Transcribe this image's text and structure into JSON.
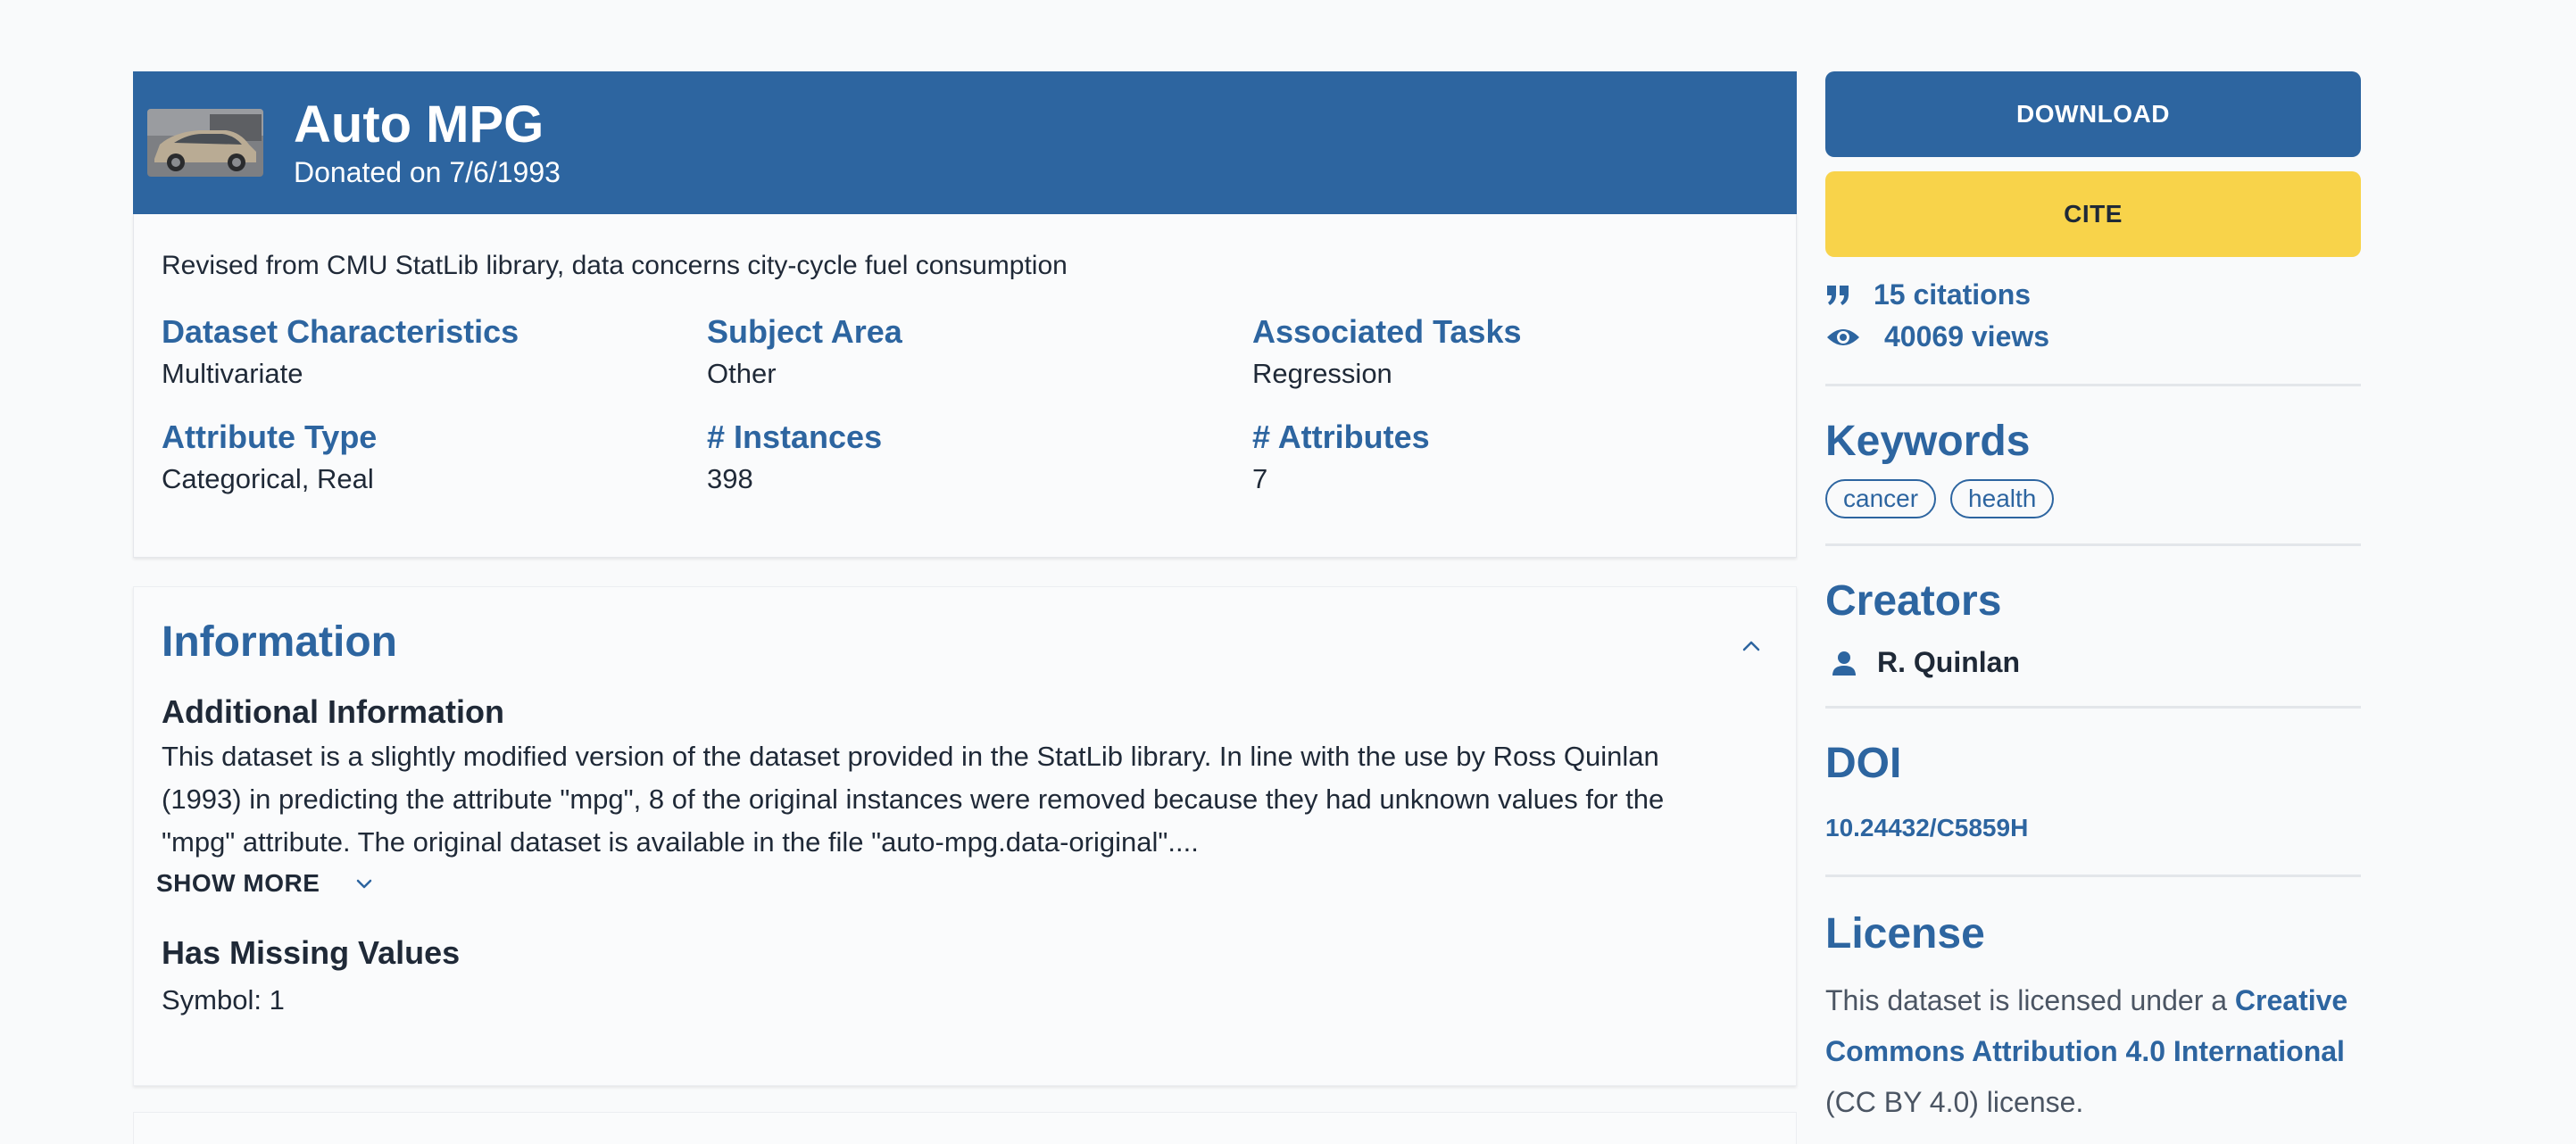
{
  "dataset": {
    "title": "Auto MPG",
    "donated": "Donated on 7/6/1993",
    "description": "Revised from CMU StatLib library, data concerns city-cycle fuel consumption",
    "facts": [
      {
        "label": "Dataset Characteristics",
        "value": "Multivariate"
      },
      {
        "label": "Subject Area",
        "value": "Other"
      },
      {
        "label": "Associated Tasks",
        "value": "Regression"
      },
      {
        "label": "Attribute Type",
        "value": "Categorical, Real"
      },
      {
        "label": "# Instances",
        "value": "398"
      },
      {
        "label": "# Attributes",
        "value": "7"
      }
    ]
  },
  "information": {
    "title": "Information",
    "additional_heading": "Additional Information",
    "additional_lines": [
      "This dataset is a slightly modified version of the dataset provided in the StatLib library.  In line with the use by Ross Quinlan",
      "(1993) in predicting the attribute \"mpg\", 8 of the original instances were removed because they had unknown values for the",
      "\"mpg\" attribute.  The original dataset is available in the file \"auto-mpg.data-original\"...."
    ],
    "show_more": "SHOW MORE",
    "missing_heading": "Has Missing Values",
    "missing_value": "Symbol: 1"
  },
  "sidebar": {
    "download_label": "DOWNLOAD",
    "cite_label": "CITE",
    "citations": "15 citations",
    "views": "40069 views",
    "keywords_heading": "Keywords",
    "keywords": [
      "cancer",
      "health"
    ],
    "creators_heading": "Creators",
    "creator": "R. Quinlan",
    "doi_heading": "DOI",
    "doi": "10.24432/C5859H",
    "license_heading": "License",
    "license_prefix": "This dataset is licensed under a ",
    "license_link": "Creative Commons Attribution 4.0 International",
    "license_suffix": " (CC BY 4.0) license."
  },
  "colors": {
    "primary": "#2d65a0",
    "cite": "#f8d34a",
    "background": "#f9fafb"
  },
  "icons": [
    "car-thumbnail",
    "chevron-up-icon",
    "chevron-down-icon",
    "quote-icon",
    "eye-icon",
    "user-icon"
  ]
}
